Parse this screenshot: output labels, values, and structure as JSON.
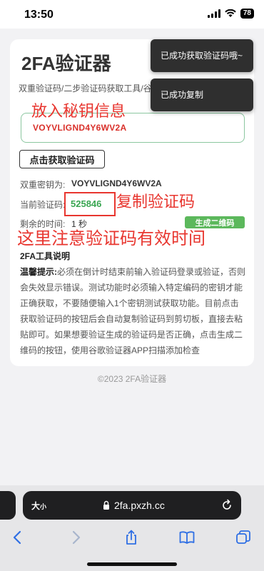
{
  "status_bar": {
    "time": "13:50",
    "battery": "78"
  },
  "page": {
    "title": "2FA验证器",
    "subtitle": "双重验证码/二步验证码获取工具/谷歌身份验证器的网页版",
    "secret_input_value": "VOYVLIGND4Y6WV2A",
    "get_code_button": "点击获取验证码",
    "secret_label": "双重密钥为:",
    "secret_value": "VOYVLIGND4Y6WV2A",
    "code_label": "当前验证码:",
    "code_value": "525846",
    "time_label": "剩余的时间:",
    "time_value": "1 秒",
    "qr_button": "生成二维码",
    "notes_title": "2FA工具说明",
    "notes_lead": "温馨提示:",
    "notes_body": "必须在倒计时结束前输入验证码登录或验证，否则会失效显示错误。测试功能时必须输入特定编码的密钥才能正确获取，不要随便输入1个密钥测试获取功能。目前点击获取验证码的按钮后会自动复制验证码到剪切板，直接去粘贴即可。如果想要验证生成的验证码是否正确，点击生成二维码的按钮，使用谷歌验证器APP扫描添加检查",
    "footer": "©2023 2FA验证器"
  },
  "toasts": [
    "已成功获取验证码哦~",
    "已成功复制"
  ],
  "annotations": [
    "放入秘钥信息",
    "复制验证码",
    "这里注意验证码有效时间"
  ],
  "browser": {
    "aa_label": "大",
    "aa_small": "小",
    "url": "2fa.pxzh.cc"
  },
  "icons": {
    "lock": "lock-icon",
    "reload": "reload-icon",
    "back": "back-icon",
    "forward": "forward-icon",
    "share": "share-icon",
    "bookmarks": "bookmarks-icon",
    "tabs": "tabs-icon"
  },
  "colors": {
    "annotation_red": "#e8362f",
    "code_green": "#3aa652",
    "qr_button_green": "#5cb85c",
    "toast_bg": "#2f2f2f"
  }
}
